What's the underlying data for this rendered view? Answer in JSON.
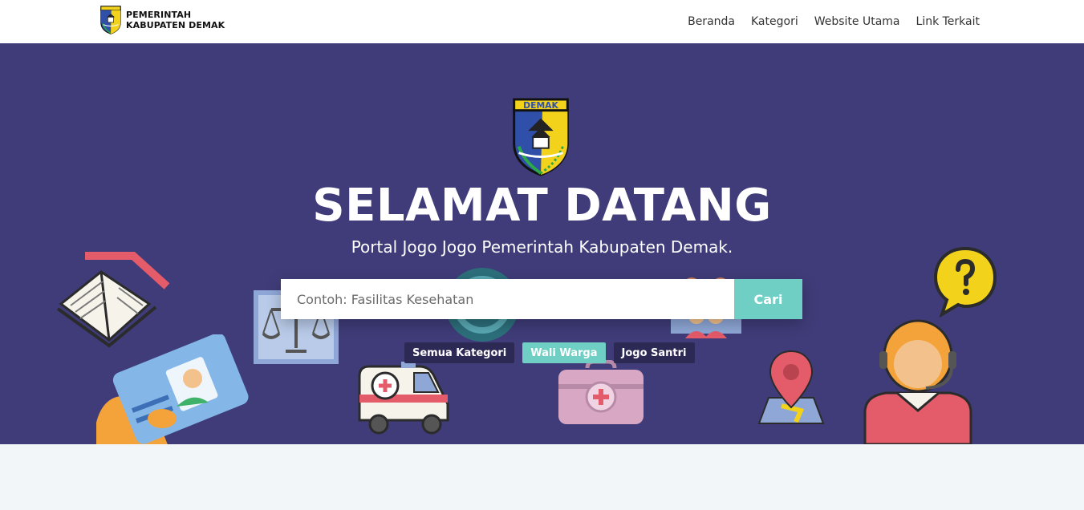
{
  "navbar": {
    "brand_line1": "PEMERINTAH",
    "brand_line2": "KABUPATEN DEMAK",
    "links": [
      "Beranda",
      "Kategori",
      "Website Utama",
      "Link Terkait"
    ]
  },
  "hero": {
    "crest_text": "DEMAK",
    "title": "SELAMAT DATANG",
    "subtitle": "Portal Jogo Jogo Pemerintah Kabupaten Demak.",
    "search": {
      "placeholder": "Contoh: Fasilitas Kesehatan",
      "button_label": "Cari"
    },
    "chips": [
      "Semua Kategori",
      "Wali Warga",
      "Jogo Santri"
    ],
    "active_chip": "Wali Warga",
    "decorations": [
      "book-icon",
      "id-card-icon",
      "justice-scale-icon",
      "whatsapp-icon",
      "ambulance-icon",
      "medical-kit-icon",
      "family-icon",
      "map-pin-icon",
      "question-bubble-icon",
      "customer-service-icon"
    ]
  },
  "colors": {
    "hero_bg": "#3f3c79",
    "accent": "#6fcfc4",
    "chip_bg": "#2c2a55",
    "navbar_bg": "#ffffff",
    "page_bg": "#f3f6f9"
  }
}
